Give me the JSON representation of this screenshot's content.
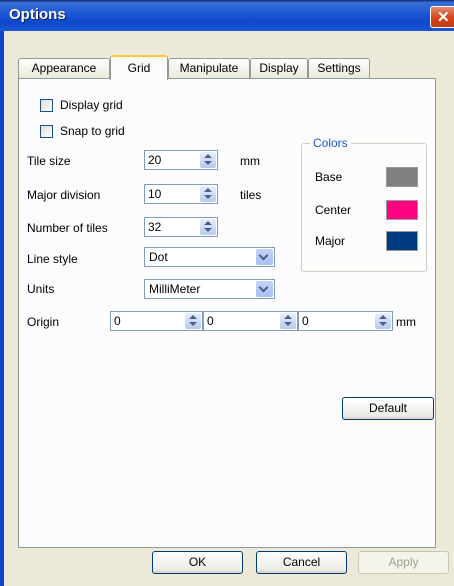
{
  "window": {
    "title": "Options",
    "close_label": "✕"
  },
  "tabs": [
    "Appearance",
    "Grid",
    "Manipulate",
    "Display",
    "Settings"
  ],
  "grid": {
    "display_grid_label": "Display grid",
    "snap_to_grid_label": "Snap to grid",
    "tile_size": {
      "label": "Tile size",
      "value": "20",
      "unit": "mm"
    },
    "major_division": {
      "label": "Major division",
      "value": "10",
      "unit": "tiles"
    },
    "number_of_tiles": {
      "label": "Number of tiles",
      "value": "32"
    },
    "line_style": {
      "label": "Line style",
      "value": "Dot"
    },
    "units": {
      "label": "Units",
      "value": "MilliMeter"
    },
    "origin": {
      "label": "Origin",
      "x": "0",
      "y": "0",
      "z": "0",
      "unit": "mm"
    },
    "colors": {
      "title": "Colors",
      "base_label": "Base",
      "base_color": "#808080",
      "center_label": "Center",
      "center_color": "#ff0080",
      "major_label": "Major",
      "major_color": "#003c80"
    },
    "default_label": "Default"
  },
  "buttons": {
    "ok": "OK",
    "cancel": "Cancel",
    "apply": "Apply"
  }
}
